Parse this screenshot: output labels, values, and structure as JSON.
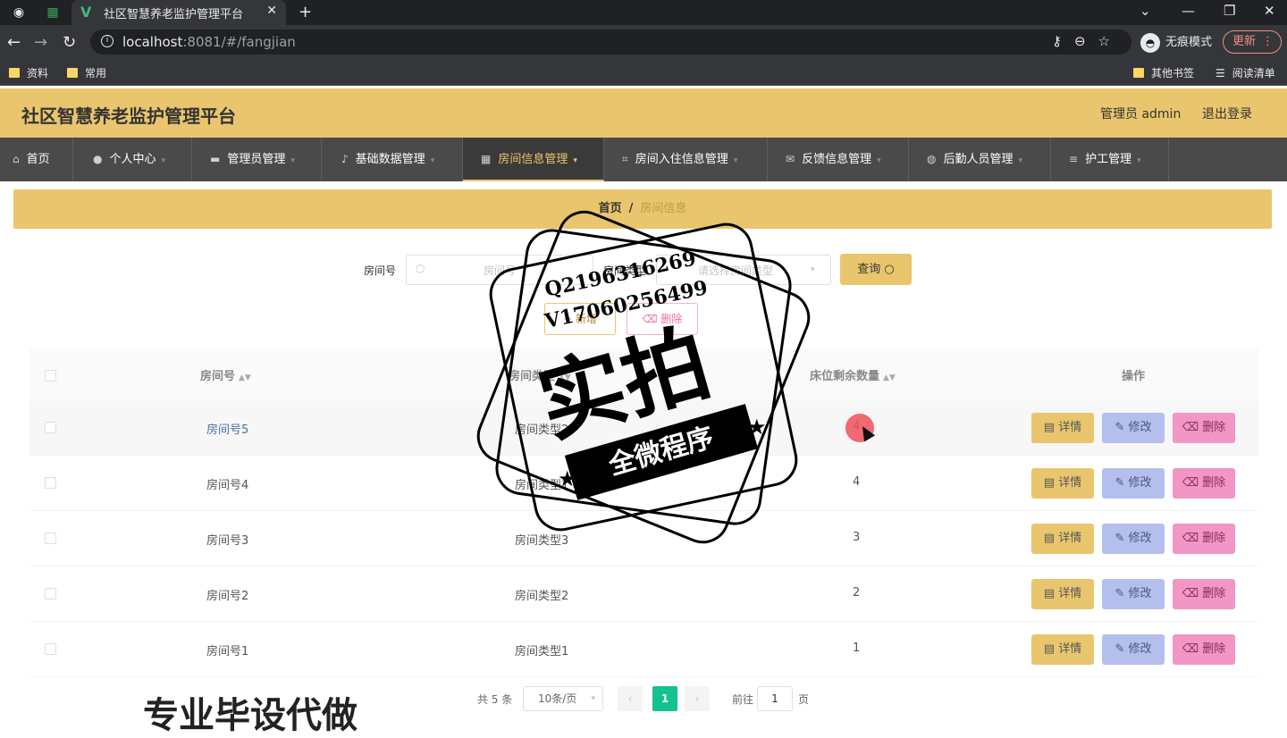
{
  "browser": {
    "tab_title": "社区智慧养老监护管理平台",
    "url_host": "localhost",
    "url_rest": ":8081/#/fangjian",
    "incognito_label": "无痕模式",
    "update_label": "更新",
    "bookmarks": [
      "资料",
      "常用"
    ],
    "bookmarks_right": [
      "其他书签",
      "阅读清单"
    ]
  },
  "header": {
    "title": "社区智慧养老监护管理平台",
    "admin": "管理员 admin",
    "logout": "退出登录"
  },
  "menu": [
    {
      "label": "首页",
      "icon": "home-icon"
    },
    {
      "label": "个人中心",
      "icon": "user-icon"
    },
    {
      "label": "管理员管理",
      "icon": "id-card-icon"
    },
    {
      "label": "基础数据管理",
      "icon": "mic-icon"
    },
    {
      "label": "房间信息管理",
      "icon": "grid-icon",
      "active": true
    },
    {
      "label": "房间入住信息管理",
      "icon": "crop-icon"
    },
    {
      "label": "反馈信息管理",
      "icon": "mail-icon"
    },
    {
      "label": "后勤人员管理",
      "icon": "globe-icon"
    },
    {
      "label": "护工管理",
      "icon": "stack-icon"
    }
  ],
  "breadcrumb": {
    "home": "首页",
    "sep": "/",
    "current": "房间信息"
  },
  "search": {
    "room_no_label": "房间号",
    "room_no_placeholder": "房间号",
    "room_type_label": "房间类型",
    "room_type_placeholder": "请选择房间类型",
    "query_label": "查询",
    "add_label": "新增",
    "delete_label": "删除"
  },
  "table": {
    "headers": [
      "房间号",
      "房间类型",
      "床位剩余数量",
      "操作"
    ],
    "rows": [
      {
        "room_no": "房间号5",
        "room_type": "房间类型2",
        "beds": "4"
      },
      {
        "room_no": "房间号4",
        "room_type": "房间类型1",
        "beds": "4"
      },
      {
        "room_no": "房间号3",
        "room_type": "房间类型3",
        "beds": "3"
      },
      {
        "room_no": "房间号2",
        "room_type": "房间类型2",
        "beds": "2"
      },
      {
        "room_no": "房间号1",
        "room_type": "房间类型1",
        "beds": "1"
      }
    ],
    "actions": {
      "detail": "详情",
      "edit": "修改",
      "delete": "删除"
    }
  },
  "pagination": {
    "total": "共 5 条",
    "page_size": "10条/页",
    "current_page": "1",
    "goto_label": "前往",
    "goto_value": "1",
    "page_suffix": "页"
  },
  "watermark": {
    "qq": "Q2196316269",
    "vx": "V17060256499",
    "big_text": "实拍",
    "ribbon": "全微程序",
    "bottom_text": "专业毕设代做"
  },
  "colors": {
    "accent": "#e9c66d",
    "menu_bg": "#4a4a4a",
    "page_current": "#13c28f",
    "edit_btn": "#b4bfee",
    "delete_btn": "#f296c5"
  }
}
